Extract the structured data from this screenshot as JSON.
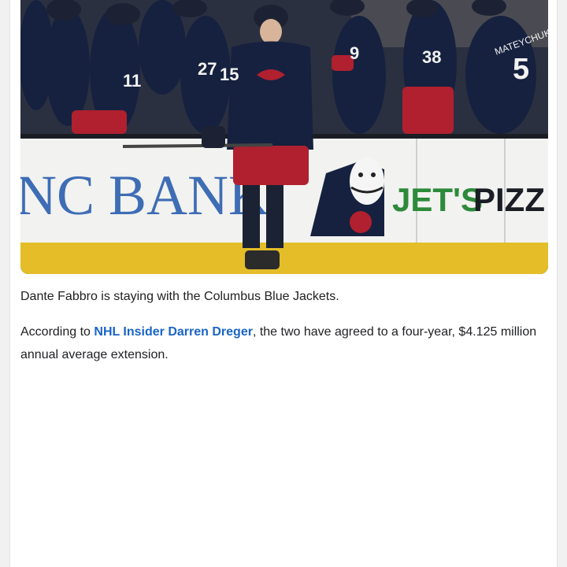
{
  "photo": {
    "icon": "hockey-celebration-photo",
    "board_text_left": "NC BANK",
    "board_text_right_colored": "JET'S",
    "board_text_right_dark": "PIZZ",
    "player_numbers": [
      "11",
      "27",
      "15",
      "9",
      "38",
      "5"
    ],
    "jersey_name": "MATEYCHUK",
    "colors": {
      "jersey_navy": "#16213f",
      "jersey_red": "#b0202f",
      "board_white": "#f2f2f0",
      "bank_blue": "#3e6db5",
      "ice_yellow": "#e4bd28"
    }
  },
  "article": {
    "paragraph1": "Dante Fabbro is staying with the Columbus Blue Jackets.",
    "paragraph2_prefix": "According to ",
    "paragraph2_link": "NHL Insider Darren Dreger",
    "paragraph2_suffix": ", the two have agreed to a four-year, $4.125 million annual average extension."
  }
}
